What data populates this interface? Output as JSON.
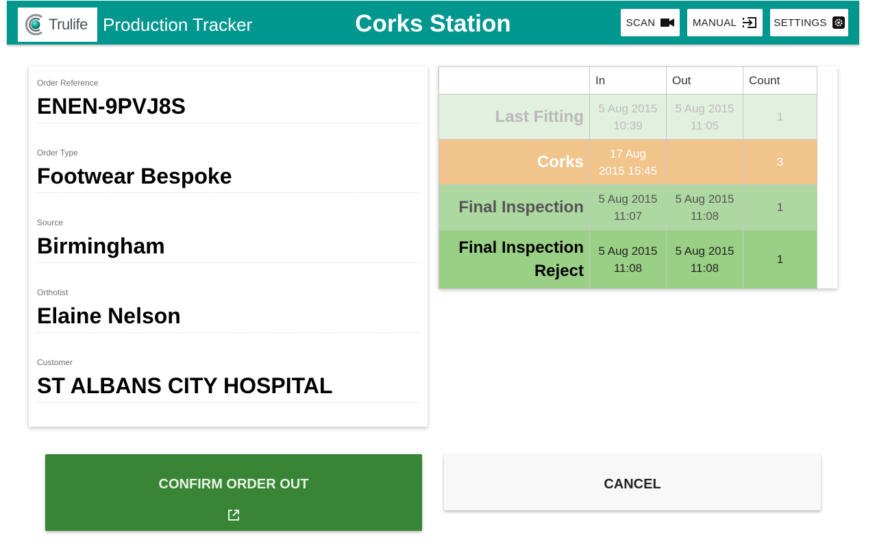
{
  "header": {
    "logo_text": "Trulife",
    "app_title": "Production Tracker",
    "station_title": "Corks Station",
    "buttons": {
      "scan": "SCAN",
      "manual": "MANUAL",
      "settings": "SETTINGS"
    },
    "brand_color": "#00978f"
  },
  "order": {
    "fields": [
      {
        "label": "Order Reference",
        "value": "ENEN-9PVJ8S"
      },
      {
        "label": "Order Type",
        "value": "Footwear Bespoke"
      },
      {
        "label": "Source",
        "value": "Birmingham"
      },
      {
        "label": "Orthotist",
        "value": "Elaine Nelson"
      },
      {
        "label": "Customer",
        "value": "ST ALBANS CITY HOSPITAL"
      }
    ]
  },
  "stages": {
    "columns": [
      "",
      "In",
      "Out",
      "Count"
    ],
    "rows": [
      {
        "stage_line1": "Last Fitting",
        "stage_line2": "",
        "in_date": "5 Aug 2015",
        "in_time": "10:39",
        "out_date": "5 Aug 2015",
        "out_time": "11:05",
        "count": "1",
        "state": "done",
        "color": "#e2f0df"
      },
      {
        "stage_line1": "Corks",
        "stage_line2": "",
        "in_date": "17 Aug",
        "in_time": "2015 15:45",
        "out_date": "",
        "out_time": "",
        "count": "3",
        "state": "current",
        "color": "#f1c48c"
      },
      {
        "stage_line1": "Final Inspection",
        "stage_line2": "",
        "in_date": "5 Aug 2015",
        "in_time": "11:07",
        "out_date": "5 Aug 2015",
        "out_time": "11:08",
        "count": "1",
        "state": "final",
        "color": "#aed8a1"
      },
      {
        "stage_line1": "Final Inspection",
        "stage_line2": "Reject",
        "in_date": "5 Aug 2015",
        "in_time": "11:08",
        "out_date": "5 Aug 2015",
        "out_time": "11:08",
        "count": "1",
        "state": "reject",
        "color": "#9ad085"
      }
    ]
  },
  "actions": {
    "confirm_label": "CONFIRM ORDER OUT",
    "cancel_label": "CANCEL",
    "confirm_color": "#378535"
  }
}
